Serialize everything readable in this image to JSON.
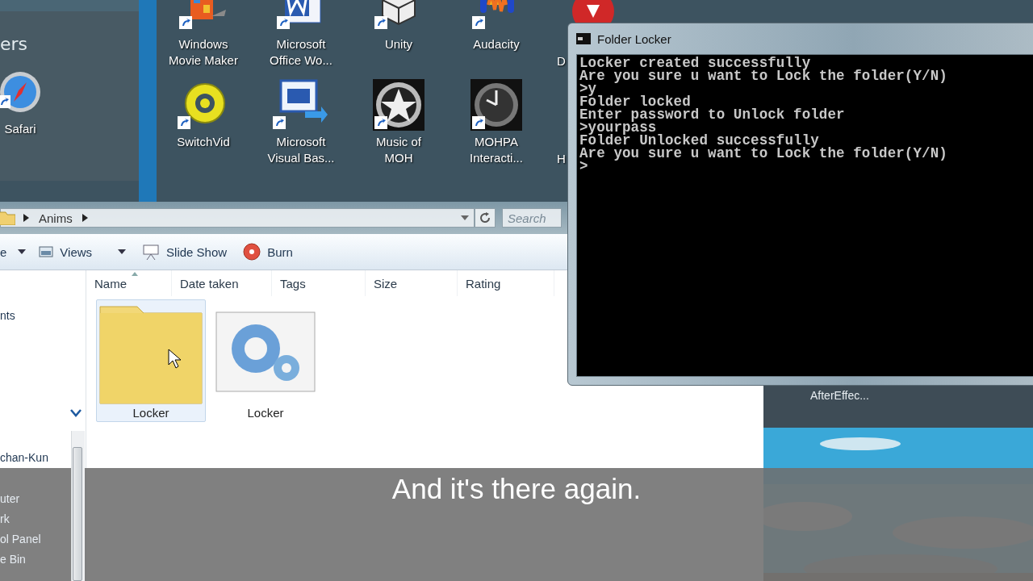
{
  "desktop": {
    "gadget_title": "ers",
    "icons": [
      {
        "label": "Windows Movie Maker"
      },
      {
        "label": "Microsoft Office Wo..."
      },
      {
        "label": "Unity"
      },
      {
        "label": "Audacity"
      },
      {
        "label": "D"
      },
      {
        "label": "Safari"
      },
      {
        "label": "SwitchVid"
      },
      {
        "label": "Microsoft Visual Bas..."
      },
      {
        "label": "Music of MOH"
      },
      {
        "label": "MOHPA Interacti..."
      },
      {
        "label": "H"
      }
    ]
  },
  "explorer": {
    "breadcrumb": [
      "Anims"
    ],
    "search": {
      "placeholder": "Search"
    },
    "toolbar": [
      {
        "label": "e",
        "dropdown": true
      },
      {
        "label": "Views",
        "dropdown": true
      },
      {
        "label": "Slide Show",
        "dropdown": false
      },
      {
        "label": "Burn",
        "dropdown": false
      }
    ],
    "columns": [
      "Name",
      "Date taken",
      "Tags",
      "Size",
      "Rating"
    ],
    "nav_items": [
      {
        "label": "nts"
      },
      {
        "label": "chan-Kun"
      },
      {
        "label": "uter"
      },
      {
        "label": "rk"
      },
      {
        "label": "ol Panel"
      },
      {
        "label": "e Bin"
      }
    ],
    "files": [
      {
        "name": "Locker",
        "kind": "folder",
        "selected": true
      },
      {
        "name": "Locker",
        "kind": "program",
        "selected": false
      }
    ]
  },
  "console": {
    "title": "Folder Locker",
    "lines": [
      "Locker created successfully",
      "Are you sure u want to Lock the folder(Y/N)",
      ">y",
      "Folder locked",
      "Enter password to Unlock folder",
      ">yourpass",
      "Folder Unlocked successfully",
      "Are you sure u want to Lock the folder(Y/N)",
      ">"
    ]
  },
  "background_window": {
    "label": "AfterEffec..."
  },
  "caption": "And it's there again."
}
